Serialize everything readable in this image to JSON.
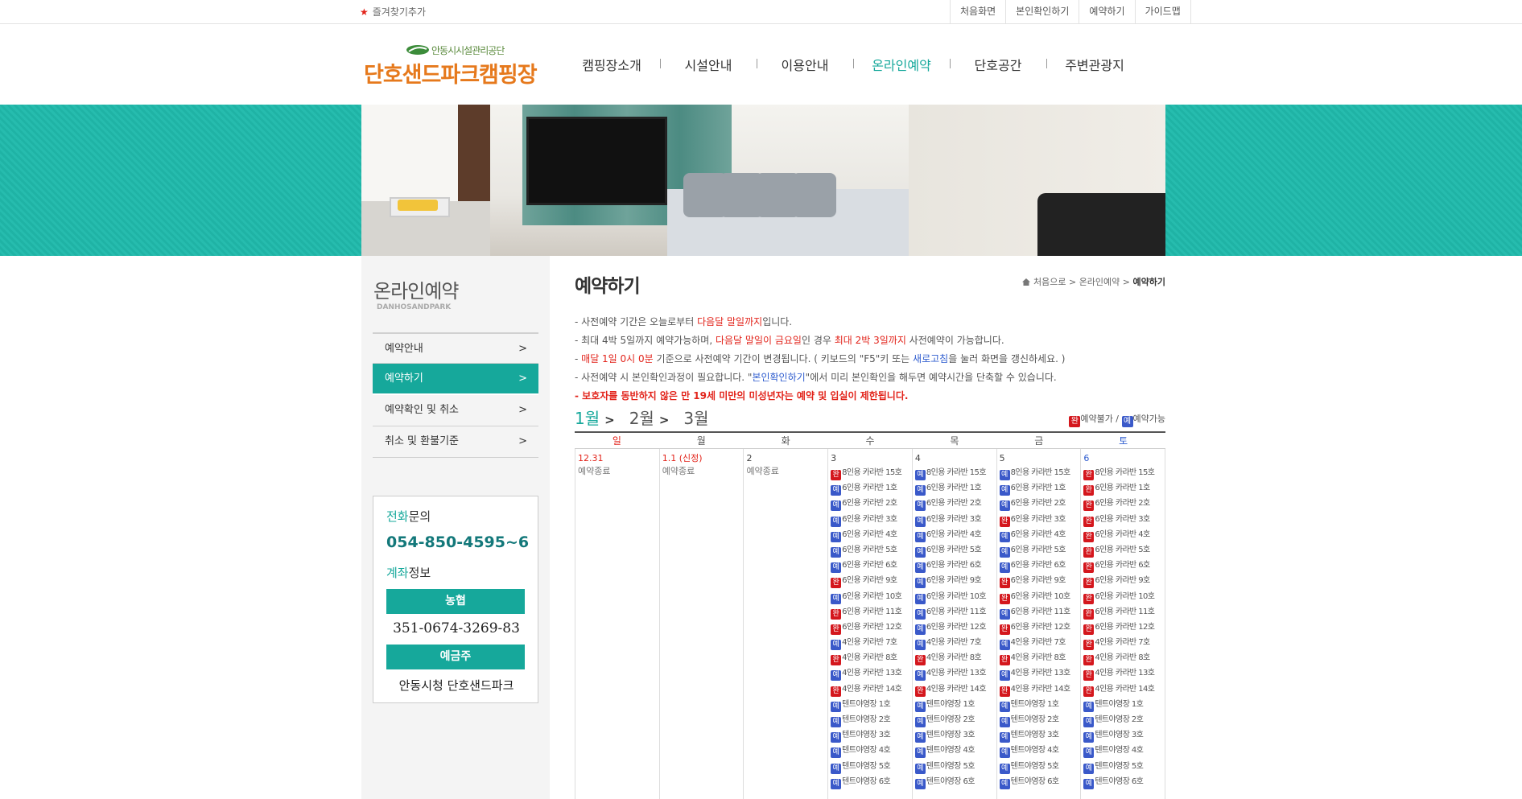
{
  "topbar": {
    "favorite": "즐겨찾기추가",
    "links": [
      "처음화면",
      "본인확인하기",
      "예약하기",
      "가이드맵"
    ]
  },
  "logo": {
    "sub": "안동시시설관리공단",
    "main": "단호샌드파크캠핑장"
  },
  "gnb": [
    "캠핑장소개",
    "시설안내",
    "이용안내",
    "온라인예약",
    "단호공간",
    "주변관광지"
  ],
  "lnb": {
    "title": "온라인예약",
    "sub": "DANHOSANDPARK",
    "items": [
      "예약안내",
      "예약하기",
      "예약확인 및 취소",
      "취소 및 환불기준"
    ],
    "phone_label_a": "전화",
    "phone_label_b": "문의",
    "phone": "054-850-4595~6",
    "account_label_a": "계좌",
    "account_label_b": "정보",
    "bank": "농협",
    "account": "351-0674-3269-83",
    "holder_label": "예금주",
    "holder": "안동시청 단호샌드파크"
  },
  "content": {
    "title": "예약하기",
    "breadcrumb": [
      "처음으로",
      "온라인예약",
      "예약하기"
    ],
    "notices": [
      [
        "- 사전예약 기간은 오늘로부터 ",
        "다음달 말일까지",
        "입니다."
      ],
      [
        "- 최대 4박 5일까지 예약가능하며, ",
        "다음달 말일이 금요일",
        "인 경우 ",
        "최대 2박 3일까지",
        " 사전예약이 가능합니다."
      ],
      [
        "- ",
        "매달 1일 0시 0분",
        " 기준으로 사전예약 기간이 변경됩니다. ( 키보드의 \"F5\"키 또는 ",
        "새로고침",
        "을 눌러 화면을 갱신하세요. )"
      ],
      [
        "- 사전예약 시 본인확인과정이 필요합니다. \"",
        "본인확인하기",
        "\"에서 미리 본인확인을 해두면 예약시간을 단축할 수 있습니다."
      ],
      [
        "- 보호자를 동반하지 않은 만 19세 미만의 미성년자는 예약 및 입실이 제한됩니다."
      ]
    ],
    "months": [
      "1월",
      "2월",
      "3월"
    ],
    "legend": {
      "full_icon": "완",
      "full_label": "예약불가",
      "sep": " / ",
      "avail_icon": "예",
      "avail_label": "예약가능"
    },
    "weekdays": [
      "일",
      "월",
      "화",
      "수",
      "목",
      "금",
      "토"
    ],
    "days": [
      "12.31",
      "1.1 (신정)",
      "2",
      "3",
      "4",
      "5",
      "6"
    ],
    "closed_label": "예약종료",
    "sites": [
      "8인용 카라반 15호",
      "6인용 카라반 1호",
      "6인용 카라반 2호",
      "6인용 카라반 3호",
      "6인용 카라반 4호",
      "6인용 카라반 5호",
      "6인용 카라반 6호",
      "6인용 카라반 9호",
      "6인용 카라반 10호",
      "6인용 카라반 11호",
      "6인용 카라반 12호",
      "4인용 카라반 7호",
      "4인용 카라반 8호",
      "4인용 카라반 13호",
      "4인용 카라반 14호",
      "텐트야영장 1호",
      "텐트야영장 2호",
      "텐트야영장 3호",
      "텐트야영장 4호",
      "텐트야영장 5호",
      "텐트야영장 6호"
    ],
    "status": {
      "3": "RBBBBBBRBRRBRBRBBBBBB",
      "4": "BBBBBBBBBBBBRBRBBBBBB",
      "5": "BBBRBBBRRBRBRBRBBBBBB",
      "6": "RRRRRRRRRRRRRRRBBBBBB"
    },
    "icon_full": "완",
    "icon_avail": "예"
  }
}
